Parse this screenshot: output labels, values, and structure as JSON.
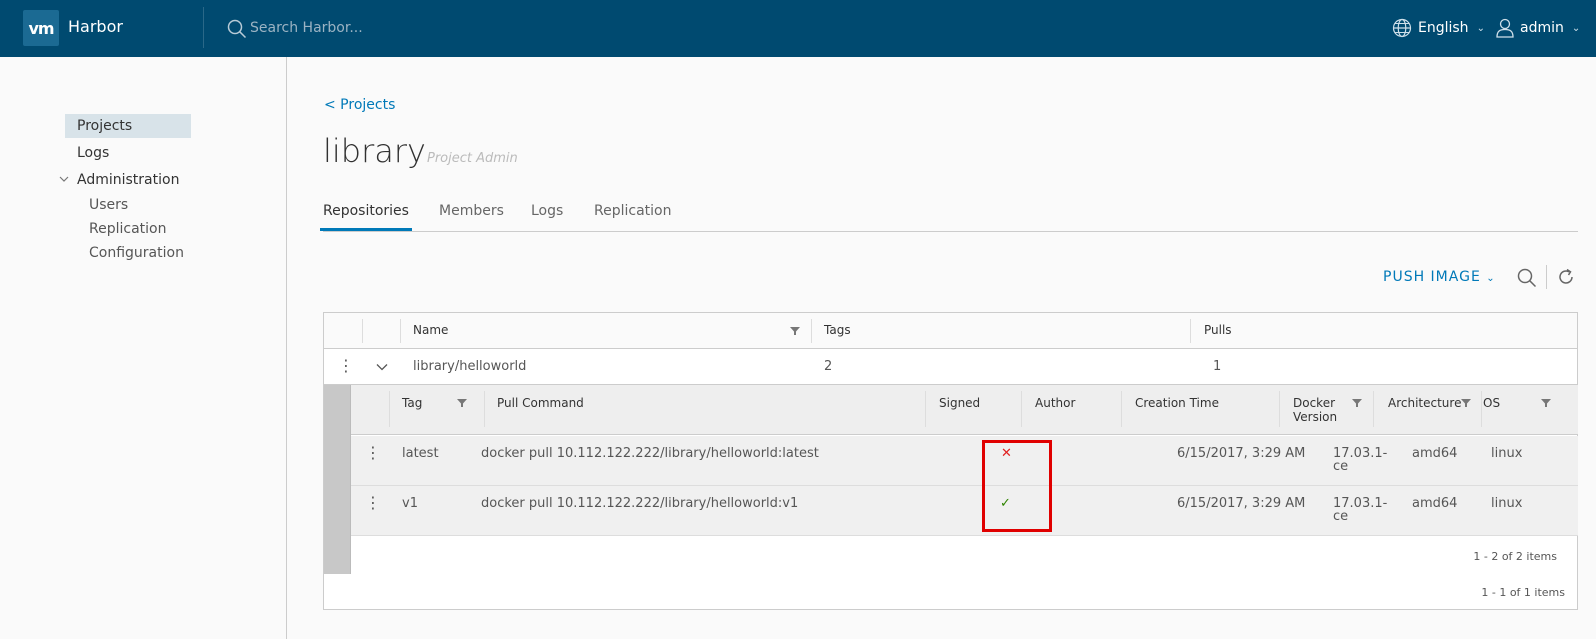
{
  "header": {
    "logo_text": "vm",
    "brand": "Harbor",
    "search_placeholder": "Search Harbor...",
    "language": "English",
    "user": "admin",
    "header_color": "#004a70"
  },
  "sidebar": {
    "items": [
      {
        "label": "Projects"
      },
      {
        "label": "Logs"
      },
      {
        "label": "Administration"
      }
    ],
    "admin_children": [
      {
        "label": "Users"
      },
      {
        "label": "Replication"
      },
      {
        "label": "Configuration"
      }
    ]
  },
  "page": {
    "back_link": "< Projects",
    "title": "library",
    "role": "Project Admin",
    "tabs": [
      {
        "label": "Repositories",
        "active": true
      },
      {
        "label": "Members"
      },
      {
        "label": "Logs"
      },
      {
        "label": "Replication"
      }
    ],
    "push_image": "PUSH IMAGE"
  },
  "repo_grid": {
    "columns": [
      "Name",
      "Tags",
      "Pulls"
    ],
    "rows": [
      {
        "name": "library/helloworld",
        "tags": "2",
        "pulls": "1"
      }
    ],
    "footer": "1 - 1 of 1 items"
  },
  "tag_grid": {
    "columns": {
      "tag": "Tag",
      "pull_command": "Pull Command",
      "signed": "Signed",
      "author": "Author",
      "creation_time": "Creation Time",
      "docker_version_1": "Docker",
      "docker_version_2": "Version",
      "architecture": "Architecture",
      "os": "OS"
    },
    "rows": [
      {
        "tag": "latest",
        "pull_command": "docker pull 10.112.122.222/library/helloworld:latest",
        "signed": "✕",
        "author": "",
        "creation_time": "6/15/2017, 3:29 AM",
        "docker_version_1": "17.03.1-",
        "docker_version_2": "ce",
        "architecture": "amd64",
        "os": "linux"
      },
      {
        "tag": "v1",
        "pull_command": "docker pull 10.112.122.222/library/helloworld:v1",
        "signed": "✓",
        "author": "",
        "creation_time": "6/15/2017, 3:29 AM",
        "docker_version_1": "17.03.1-",
        "docker_version_2": "ce",
        "architecture": "amd64",
        "os": "linux"
      }
    ],
    "footer": "1 - 2 of 2 items"
  },
  "colors": {
    "accent": "#0079b8",
    "unsigned": "#e02020",
    "signed": "#2f8400",
    "highlight": "#e00000"
  }
}
